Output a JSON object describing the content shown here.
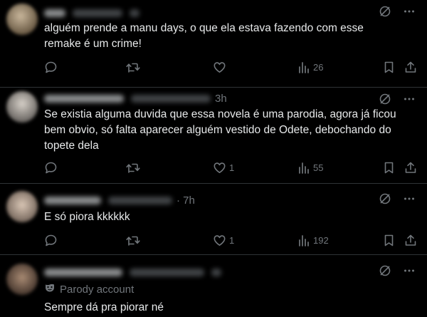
{
  "posts": [
    {
      "time": "",
      "text": "alguém prende a manu days, o que ela estava fazendo com esse remake é um crime!",
      "replies": "",
      "reposts": "",
      "likes": "",
      "views": "26"
    },
    {
      "time": "3h",
      "text": "Se existia alguma duvida que essa novela é uma parodia, agora já ficou bem obvio, só falta aparecer alguém vestido de Odete, debochando do topete dela",
      "replies": "",
      "reposts": "",
      "likes": "1",
      "views": "55"
    },
    {
      "time": "· 7h",
      "text": "E só piora kkkkkk",
      "replies": "",
      "reposts": "",
      "likes": "1",
      "views": "192"
    },
    {
      "time": "",
      "parody_label": "Parody account",
      "text": "Sempre dá pra piorar né"
    }
  ],
  "colors": {
    "background": "#000000",
    "text": "#e7e9ea",
    "muted": "#71767b",
    "divider": "#2f3336"
  },
  "icons": [
    "grok-icon",
    "more-icon",
    "reply-icon",
    "repost-icon",
    "like-icon",
    "views-icon",
    "bookmark-icon",
    "share-icon",
    "parody-mask-icon"
  ]
}
